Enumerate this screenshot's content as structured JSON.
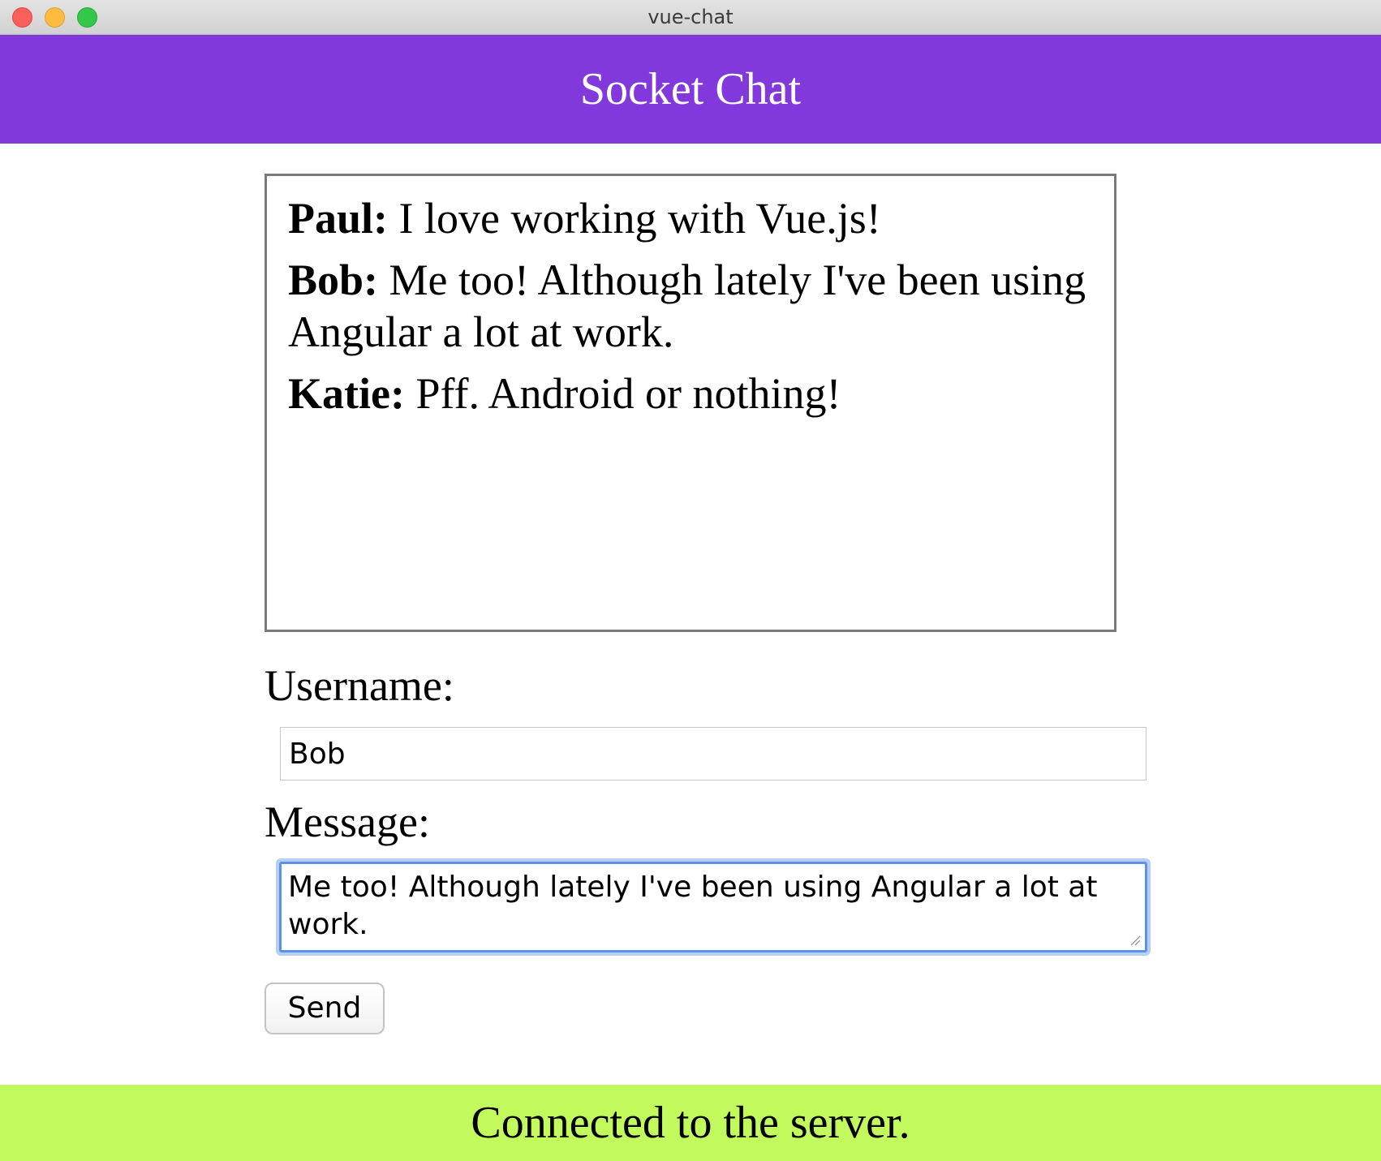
{
  "window": {
    "title": "vue-chat"
  },
  "header": {
    "title": "Socket Chat"
  },
  "chat": {
    "messages": [
      {
        "user": "Paul:",
        "text": "I love working with Vue.js!"
      },
      {
        "user": "Bob:",
        "text": "Me too! Although lately I've been using Angular a lot at work."
      },
      {
        "user": "Katie:",
        "text": "Pff. Android or nothing!"
      }
    ]
  },
  "form": {
    "username_label": "Username:",
    "username_value": "Bob",
    "message_label": "Message:",
    "message_value": "Me too! Although lately I've been using Angular a lot at work.",
    "send_label": "Send"
  },
  "status": {
    "text": "Connected to the server."
  },
  "colors": {
    "header_bg": "#8139db",
    "status_bg": "#c2fa5e",
    "focus_ring": "#5d93e6"
  },
  "icons": {
    "close": "close-icon",
    "minimize": "minimize-icon",
    "maximize": "maximize-icon",
    "resize": "resize-grip-icon"
  }
}
